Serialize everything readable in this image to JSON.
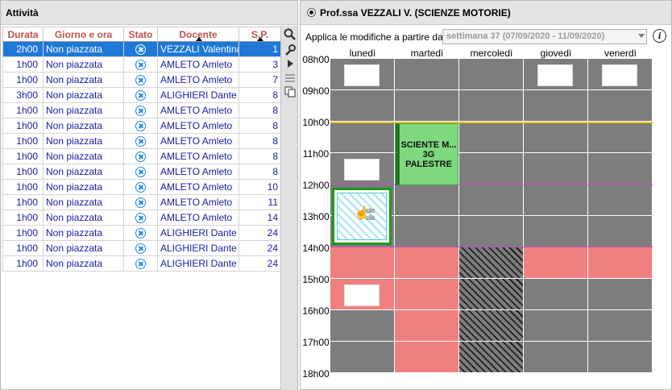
{
  "left_panel": {
    "title": "Attività"
  },
  "table": {
    "headers": [
      "Durata",
      "Giorno e ora",
      "Stato",
      "Docente",
      "S.P."
    ],
    "rows": [
      {
        "durata": "2h00",
        "giorno": "Non piazzata",
        "docente": "VEZZALI Valentina",
        "sp": "1"
      },
      {
        "durata": "1h00",
        "giorno": "Non piazzata",
        "docente": "AMLETO Amleto",
        "sp": "3"
      },
      {
        "durata": "1h00",
        "giorno": "Non piazzata",
        "docente": "AMLETO Amleto",
        "sp": "7"
      },
      {
        "durata": "3h00",
        "giorno": "Non piazzata",
        "docente": "ALIGHIERI Dante",
        "sp": "8"
      },
      {
        "durata": "1h00",
        "giorno": "Non piazzata",
        "docente": "AMLETO Amleto",
        "sp": "8"
      },
      {
        "durata": "1h00",
        "giorno": "Non piazzata",
        "docente": "AMLETO Amleto",
        "sp": "8"
      },
      {
        "durata": "1h00",
        "giorno": "Non piazzata",
        "docente": "AMLETO Amleto",
        "sp": "8"
      },
      {
        "durata": "1h00",
        "giorno": "Non piazzata",
        "docente": "AMLETO Amleto",
        "sp": "8"
      },
      {
        "durata": "1h00",
        "giorno": "Non piazzata",
        "docente": "AMLETO Amleto",
        "sp": "8"
      },
      {
        "durata": "1h00",
        "giorno": "Non piazzata",
        "docente": "AMLETO Amleto",
        "sp": "10"
      },
      {
        "durata": "1h00",
        "giorno": "Non piazzata",
        "docente": "AMLETO Amleto",
        "sp": "11"
      },
      {
        "durata": "1h00",
        "giorno": "Non piazzata",
        "docente": "AMLETO Amleto",
        "sp": "14"
      },
      {
        "durata": "1h00",
        "giorno": "Non piazzata",
        "docente": "ALIGHIERI Dante",
        "sp": "24"
      },
      {
        "durata": "1h00",
        "giorno": "Non piazzata",
        "docente": "ALIGHIERI Dante",
        "sp": "24"
      },
      {
        "durata": "1h00",
        "giorno": "Non piazzata",
        "docente": "ALIGHIERI Dante",
        "sp": "24"
      }
    ]
  },
  "toolbar": {
    "icons": [
      "search-icon",
      "wrench-icon",
      "play-icon",
      "list-icon",
      "copy-icon"
    ]
  },
  "right_panel": {
    "teacher": "Prof.ssa VEZZALI V. (SCIENZE MOTORIE)",
    "apply_label": "Applica le modifiche a partire dalla",
    "week_value": "settimana 37 (07/09/2020 - 11/09/2020)",
    "info_icon": "i"
  },
  "schedule": {
    "days": [
      "lunedì",
      "martedì",
      "mercoledì",
      "giovedì",
      "venerdì"
    ],
    "hours": [
      "08h00",
      "09h00",
      "10h00",
      "11h00",
      "12h00",
      "13h00",
      "14h00",
      "15h00",
      "16h00",
      "17h00",
      "18h00"
    ],
    "course": {
      "line1": "SCIENTE M...",
      "line2": "3G",
      "line3": "PALESTRE"
    },
    "cursor_hint": "clic\nclic",
    "colors": {
      "busy": "#7d7d7d",
      "unavailable": "#f08080",
      "course": "#7ed87e",
      "selection": "#1a9a1a",
      "noon_line": "#f0c020",
      "afternoon_line": "#c050c0"
    }
  }
}
